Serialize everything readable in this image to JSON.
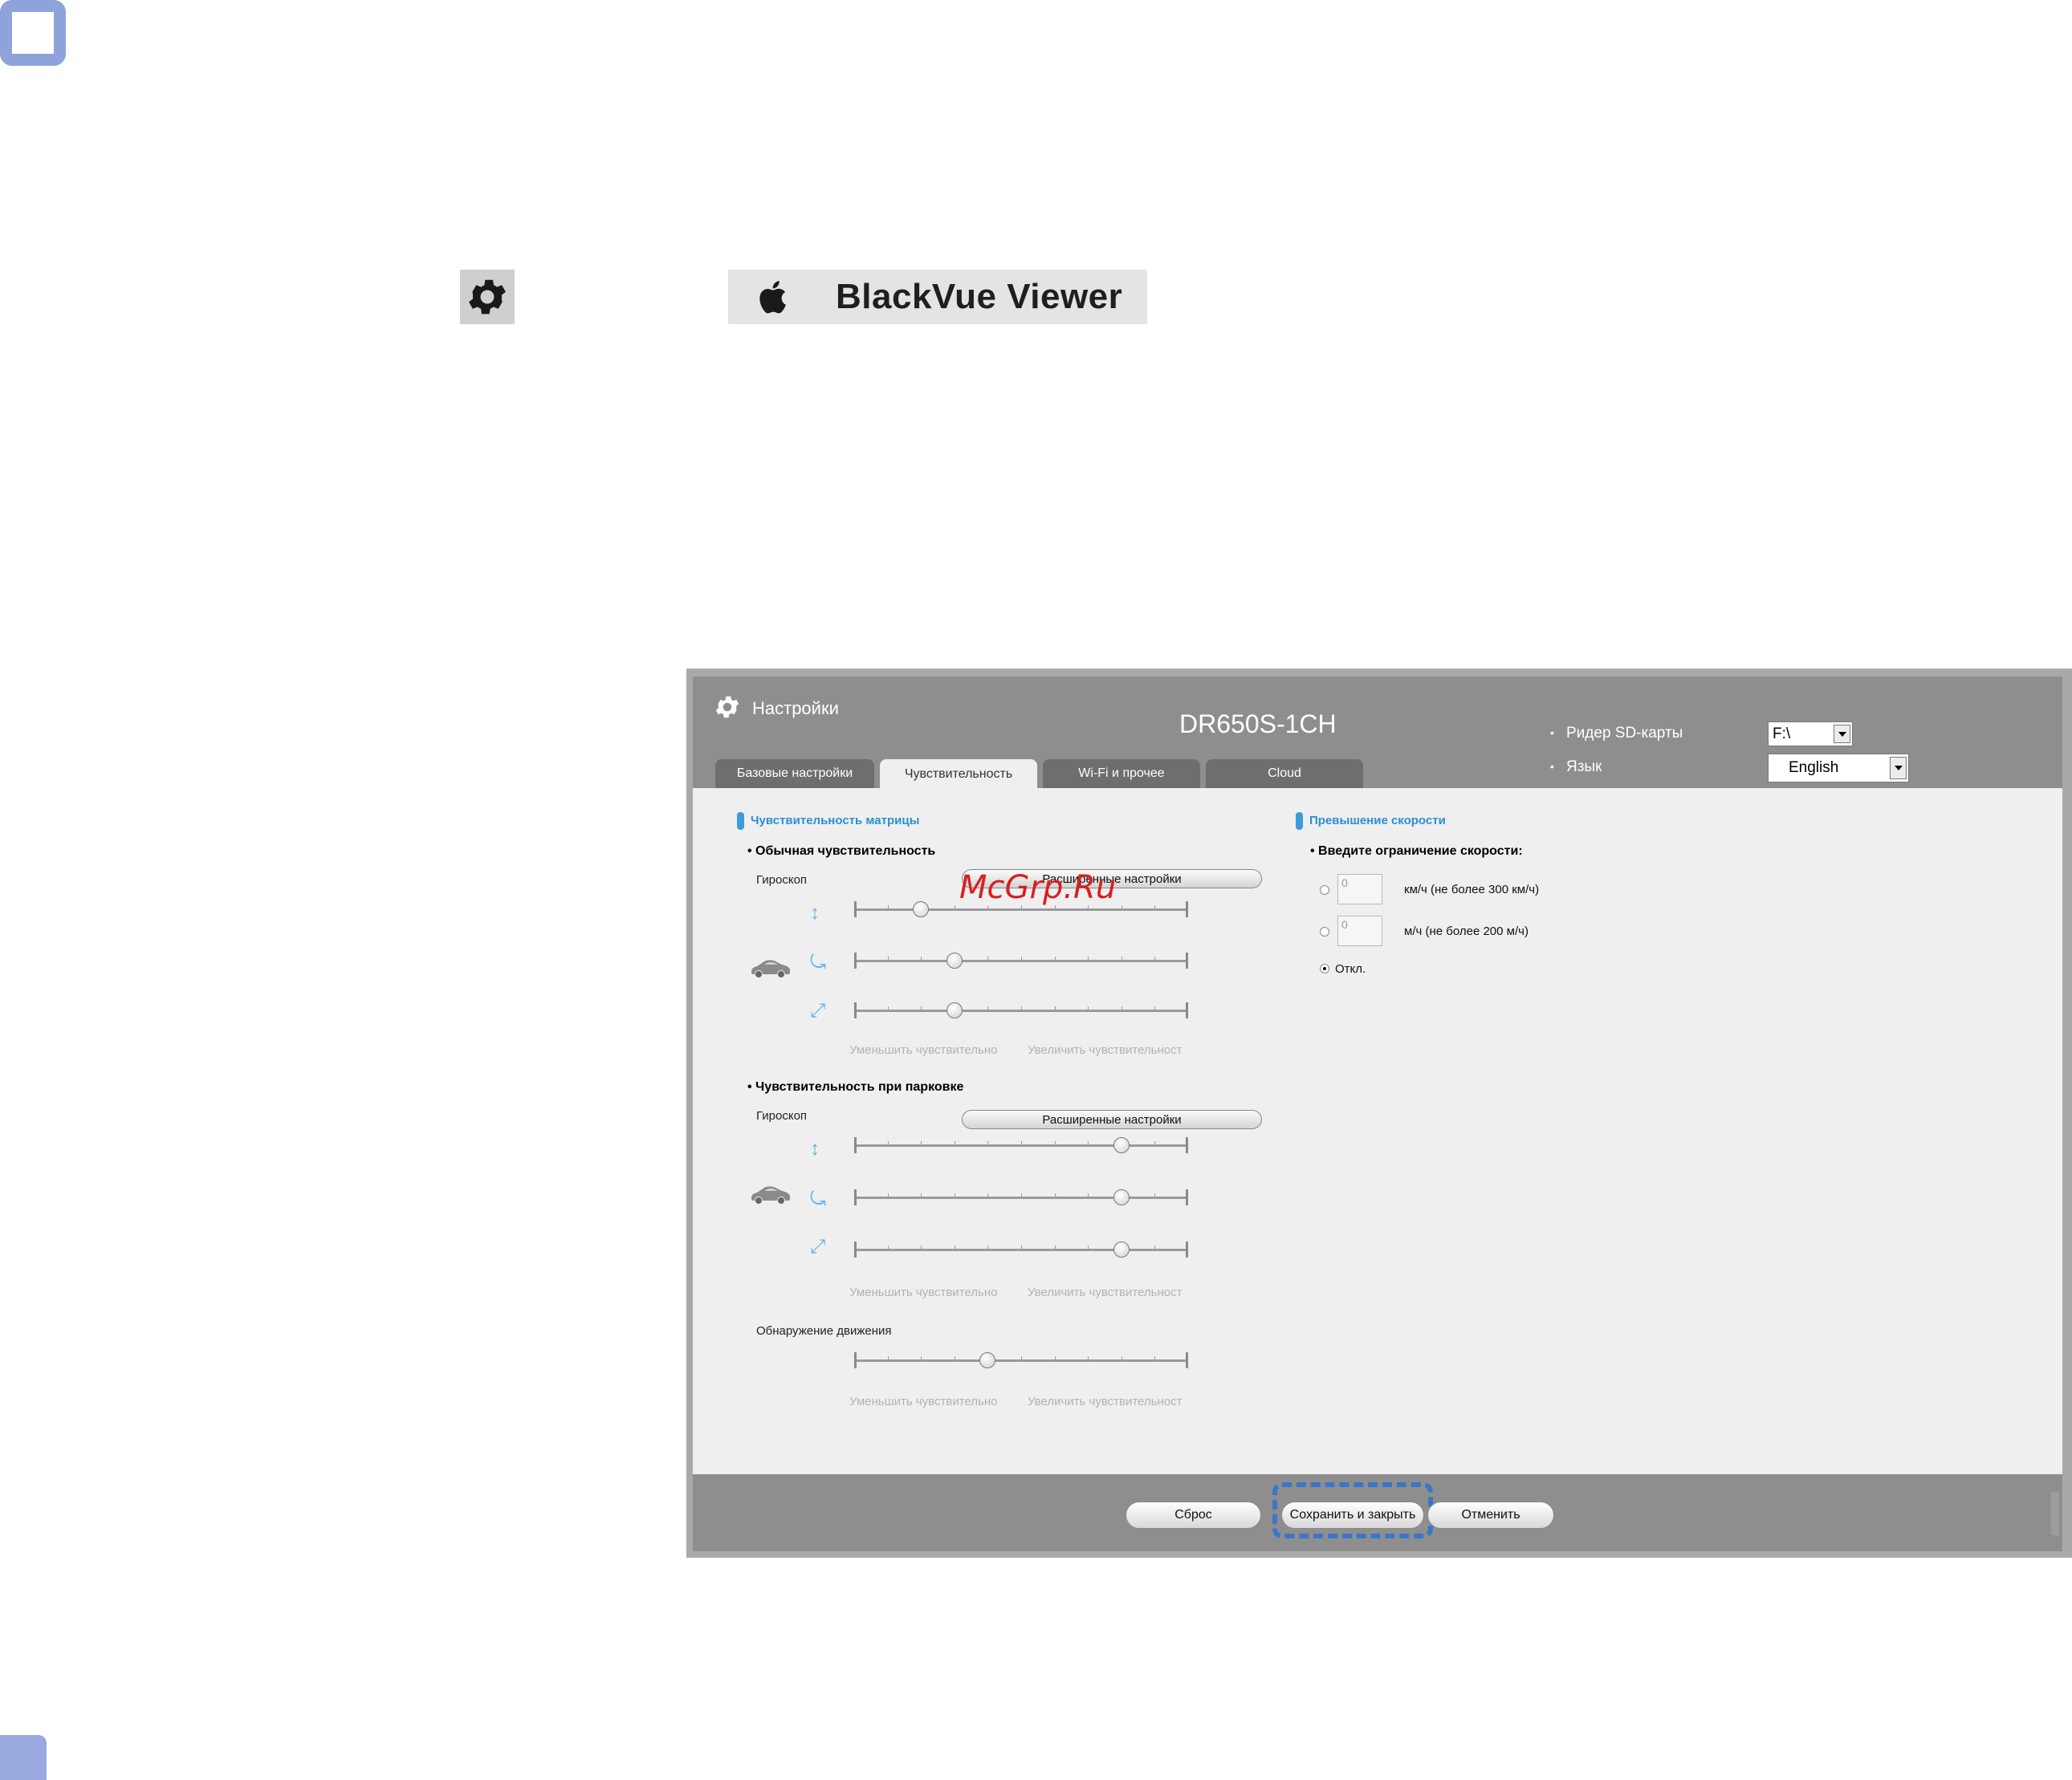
{
  "banner": {
    "app_name": "BlackVue Viewer"
  },
  "icons": {
    "settings": "gear-icon",
    "apple": "apple-logo-icon"
  },
  "window": {
    "title": "Настройки",
    "model": "DR650S-1CH",
    "sd_reader_label": "Ридер SD-карты",
    "sd_reader_value": "F:\\",
    "language_label": "Язык",
    "language_value": "English"
  },
  "tabs": [
    {
      "label": "Базовые настройки",
      "active": false
    },
    {
      "label": "Чувствительность",
      "active": true
    },
    {
      "label": "Wi-Fi и прочее",
      "active": false
    },
    {
      "label": "Cloud",
      "active": false
    }
  ],
  "sensitivity": {
    "section_title": "Чувствительность матрицы",
    "normal": {
      "title": "• Обычная чувствительность",
      "gyro_label": "Гироскоп",
      "advanced_label": "Расширенные настройки",
      "axes": [
        {
          "icon": "vertical-axis-icon",
          "level": 0.2
        },
        {
          "icon": "rotation-axis-icon",
          "level": 0.3
        },
        {
          "icon": "diagonal-axis-icon",
          "level": 0.3
        }
      ],
      "decrease_label": "Уменьшить чувствительно",
      "increase_label": "Увеличить чувствительност"
    },
    "parking": {
      "title": "• Чувствительность при парковке",
      "gyro_label": "Гироскоп",
      "advanced_label": "Расширенные настройки",
      "axes": [
        {
          "icon": "vertical-axis-icon",
          "level": 0.8
        },
        {
          "icon": "rotation-axis-icon",
          "level": 0.8
        },
        {
          "icon": "diagonal-axis-icon",
          "level": 0.8
        }
      ],
      "decrease_label": "Уменьшить чувствительно",
      "increase_label": "Увеличить чувствительност"
    },
    "motion": {
      "label": "Обнаружение движения",
      "level": 0.4,
      "decrease_label": "Уменьшить чувствительно",
      "increase_label": "Увеличить чувствительност"
    }
  },
  "speeding": {
    "section_title": "Превышение скорости",
    "prompt": "• Введите ограничение скорости:",
    "options": [
      {
        "input_value": "0",
        "label": "км/ч (не более 300 км/ч)",
        "selected": false
      },
      {
        "input_value": "0",
        "label": "м/ч (не более 200 м/ч)",
        "selected": false
      },
      {
        "label": "Откл.",
        "selected": true
      }
    ]
  },
  "footer": {
    "reset": "Сброс",
    "save_close": "Сохранить и закрыть",
    "cancel": "Отменить"
  },
  "watermark": "McGrp.Ru",
  "colors": {
    "accent": "#2a8fd0",
    "window_gray": "#8e8e8e",
    "panel_bg": "#efefef",
    "focus": "#3a76c9"
  }
}
